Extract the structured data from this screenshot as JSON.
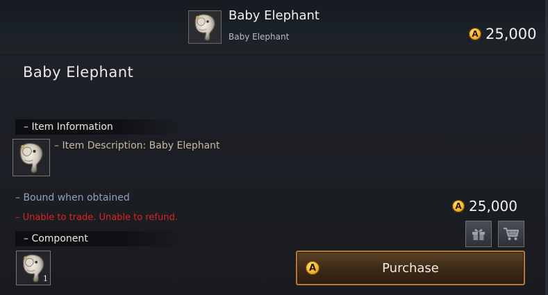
{
  "header": {
    "title": "Baby Elephant",
    "subtitle": "Baby Elephant",
    "currency_symbol": "A",
    "price": "25,000",
    "icon": "elephant-mask-icon"
  },
  "item": {
    "name": "Baby Elephant"
  },
  "item_information": {
    "heading": "– Item Information",
    "description": "– Item Description: Baby Elephant",
    "icon": "elephant-mask-icon"
  },
  "restrictions": {
    "bound": "– Bound when obtained",
    "trade": "– Unable to trade. Unable to refund."
  },
  "component": {
    "heading": "– Component",
    "quantity": "1",
    "icon": "elephant-mask-icon"
  },
  "purchase_area": {
    "currency_symbol": "A",
    "price": "25,000",
    "gift_icon": "gift-icon",
    "cart_icon": "cart-icon",
    "button_label": "Purchase"
  },
  "colors": {
    "coin_gold": "#f2b12a",
    "warning_red": "#e02222",
    "bound_blue": "#8fa1bb",
    "description_tan": "#c6b9a0",
    "purchase_border": "#b7783a"
  }
}
